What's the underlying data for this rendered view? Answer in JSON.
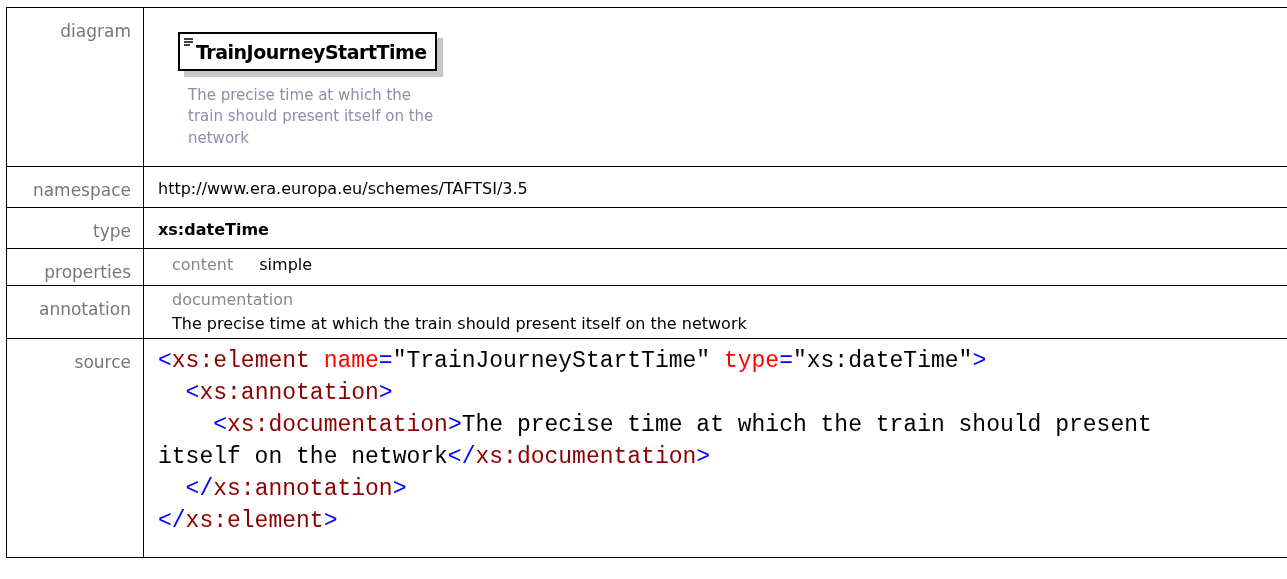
{
  "rows": [
    {
      "kind": "diagram",
      "label": "diagram",
      "element_name": "TrainJourneyStartTime",
      "element_doc": "The precise time at which the train should present itself on the network"
    },
    {
      "kind": "text",
      "label": "namespace",
      "value": "http://www.era.europa.eu/schemes/TAFTSI/3.5",
      "bold": false
    },
    {
      "kind": "text",
      "label": "type",
      "value": "xs:dateTime",
      "bold": true
    },
    {
      "kind": "properties",
      "label": "properties",
      "items": [
        {
          "key": "content",
          "value": "simple"
        }
      ]
    },
    {
      "kind": "annotation",
      "label": "annotation",
      "heading": "documentation",
      "value": "The precise time at which the train should present itself on the network"
    },
    {
      "kind": "source",
      "label": "source",
      "lines": [
        [
          {
            "kind": "bracket",
            "text": "<"
          },
          {
            "kind": "tag",
            "text": "xs:element"
          },
          {
            "kind": "attr",
            "text": " name"
          },
          {
            "kind": "bracket",
            "text": "="
          },
          {
            "kind": "value",
            "text": "\"TrainJourneyStartTime\""
          },
          {
            "kind": "attr",
            "text": " type"
          },
          {
            "kind": "bracket",
            "text": "="
          },
          {
            "kind": "value",
            "text": "\"xs:dateTime\""
          },
          {
            "kind": "bracket",
            "text": ">"
          }
        ],
        [
          {
            "kind": "bracket",
            "text": "  <"
          },
          {
            "kind": "tag",
            "text": "xs:annotation"
          },
          {
            "kind": "bracket",
            "text": ">"
          }
        ],
        [
          {
            "kind": "bracket",
            "text": "    <"
          },
          {
            "kind": "tag",
            "text": "xs:documentation"
          },
          {
            "kind": "bracket",
            "text": ">"
          },
          {
            "kind": "content",
            "text": "The precise time at which the train should present itself on the network"
          },
          {
            "kind": "bracket",
            "text": "</"
          },
          {
            "kind": "tag",
            "text": "xs:documentation"
          },
          {
            "kind": "bracket",
            "text": ">"
          }
        ],
        [
          {
            "kind": "bracket",
            "text": "  </"
          },
          {
            "kind": "tag",
            "text": "xs:annotation"
          },
          {
            "kind": "bracket",
            "text": ">"
          }
        ],
        [
          {
            "kind": "bracket",
            "text": "</"
          },
          {
            "kind": "tag",
            "text": "xs:element"
          },
          {
            "kind": "bracket",
            "text": ">"
          }
        ]
      ]
    }
  ]
}
